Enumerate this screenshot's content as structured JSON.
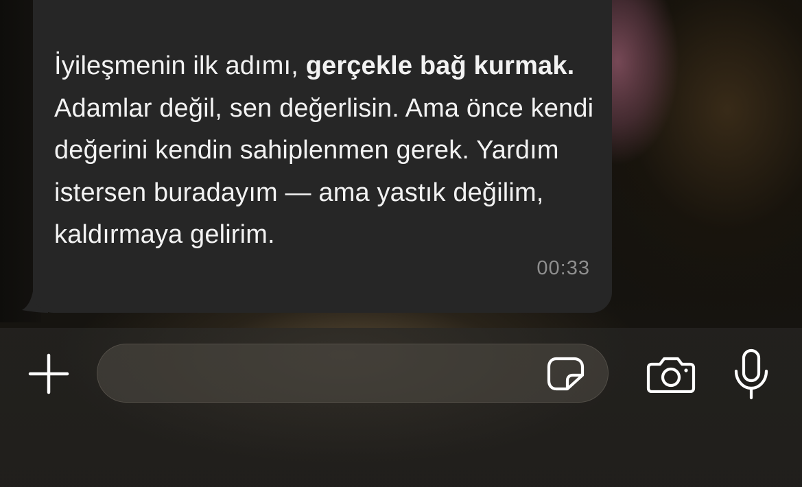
{
  "message": {
    "segments": [
      {
        "text": "İyileşmenin ilk adımı, ",
        "bold": false
      },
      {
        "text": "gerçekle bağ kurmak.",
        "bold": true
      },
      {
        "text": " Adamlar değil, sen değerlisin. Ama önce kendi değerini kendin sahiplenmen gerek. Yardım istersen buradayım — ama yastık değilim, kaldırmaya gelirim.",
        "bold": false
      }
    ],
    "time": "00:33"
  },
  "compose": {
    "input_value": "",
    "input_placeholder": "",
    "icons": {
      "attach": "plus-icon",
      "sticker": "sticker-icon",
      "camera": "camera-icon",
      "microphone": "microphone-icon"
    }
  },
  "colors": {
    "bubble": "#262626",
    "text": "#f2f2f2",
    "timestamp": "#8e8e8e",
    "icon": "#ffffff"
  }
}
